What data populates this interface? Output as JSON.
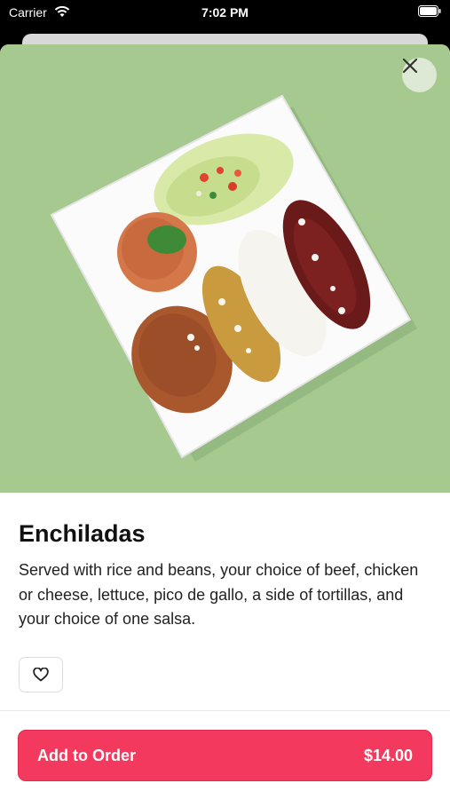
{
  "status_bar": {
    "carrier": "Carrier",
    "time": "7:02 PM"
  },
  "hero_image": {
    "icon": "food-photo",
    "subject": "enchiladas-plate"
  },
  "item": {
    "title": "Enchiladas",
    "description": "Served with rice and beans, your choice of beef, chicken or cheese, lettuce, pico de gallo, a side of tortillas, and your choice of one salsa."
  },
  "actions": {
    "add_label": "Add to Order",
    "price": "$14.00"
  },
  "colors": {
    "accent": "#f33a5e",
    "hero_background": "#a6c98f"
  }
}
